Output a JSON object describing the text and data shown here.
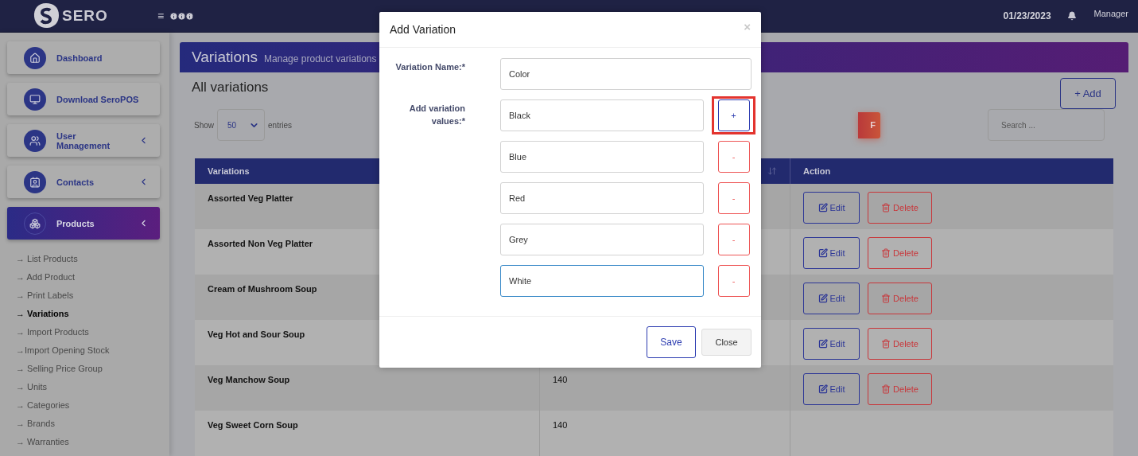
{
  "header": {
    "brand": "SERO",
    "menu_glyph": "≡",
    "date": "01/23/2023",
    "user": "Manager"
  },
  "sidebar": {
    "items": [
      {
        "label": "Dashboard",
        "selected": false,
        "expandable": false
      },
      {
        "label": "Download SeroPOS",
        "selected": false,
        "expandable": false
      },
      {
        "label": "User Management",
        "selected": false,
        "expandable": true
      },
      {
        "label": "Contacts",
        "selected": false,
        "expandable": true
      },
      {
        "label": "Products",
        "selected": true,
        "expandable": true
      }
    ],
    "submenu": [
      {
        "label": "→ List Products",
        "selected": false
      },
      {
        "label": "→ Add Product",
        "selected": false
      },
      {
        "label": "→ Print Labels",
        "selected": false
      },
      {
        "label": "→ Variations",
        "selected": true
      },
      {
        "label": "→ Import Products",
        "selected": false
      },
      {
        "label": "→Import Opening Stock",
        "selected": false
      },
      {
        "label": "→ Selling Price Group",
        "selected": false
      },
      {
        "label": "→ Units",
        "selected": false
      },
      {
        "label": "→ Categories",
        "selected": false
      },
      {
        "label": "→ Brands",
        "selected": false
      },
      {
        "label": "→ Warranties",
        "selected": false
      }
    ]
  },
  "page": {
    "title": "Variations",
    "subtitle": "Manage product variations",
    "heading": "All variations",
    "add_button": "+ Add",
    "show_label": "Show",
    "page_size": "50",
    "entries_label": "entries",
    "export_button": "F",
    "search_placeholder": "Search ...",
    "table": {
      "columns": [
        {
          "label": "Variations"
        },
        {
          "sort_icon": true
        },
        {
          "label": "Action"
        }
      ],
      "rows": [
        {
          "name": "Assorted Veg Platter",
          "edit": "Edit",
          "delete": "Delete"
        },
        {
          "name": "Assorted Non Veg Platter",
          "edit": "Edit",
          "delete": "Delete"
        },
        {
          "name": "Cream of Mushroom Soup",
          "edit": "Edit",
          "delete": "Delete"
        },
        {
          "name": "Veg Hot and Sour Soup",
          "edit": "Edit",
          "delete": "Delete"
        },
        {
          "name": "Veg Manchow Soup",
          "column_2": "140",
          "edit": "Edit",
          "delete": "Delete"
        },
        {
          "name": "Veg Sweet Corn Soup",
          "column_2": "140"
        }
      ]
    }
  },
  "modal": {
    "title": "Add Variation",
    "close_glyph": "×",
    "name_label": "Variation Name:*",
    "name_value": "Color",
    "values_label": "Add variation values:*",
    "values": [
      {
        "value": "Black",
        "kind": "add",
        "button": "+",
        "focused": false,
        "highlighted": true
      },
      {
        "value": "Blue",
        "kind": "remove",
        "button": "-",
        "focused": false,
        "highlighted": false
      },
      {
        "value": "Red",
        "kind": "remove",
        "button": "-",
        "focused": false,
        "highlighted": false
      },
      {
        "value": "Grey",
        "kind": "remove",
        "button": "-",
        "focused": false,
        "highlighted": false
      },
      {
        "value": "White",
        "kind": "remove",
        "button": "-",
        "focused": true,
        "highlighted": false
      }
    ],
    "save": "Save",
    "close": "Close"
  }
}
